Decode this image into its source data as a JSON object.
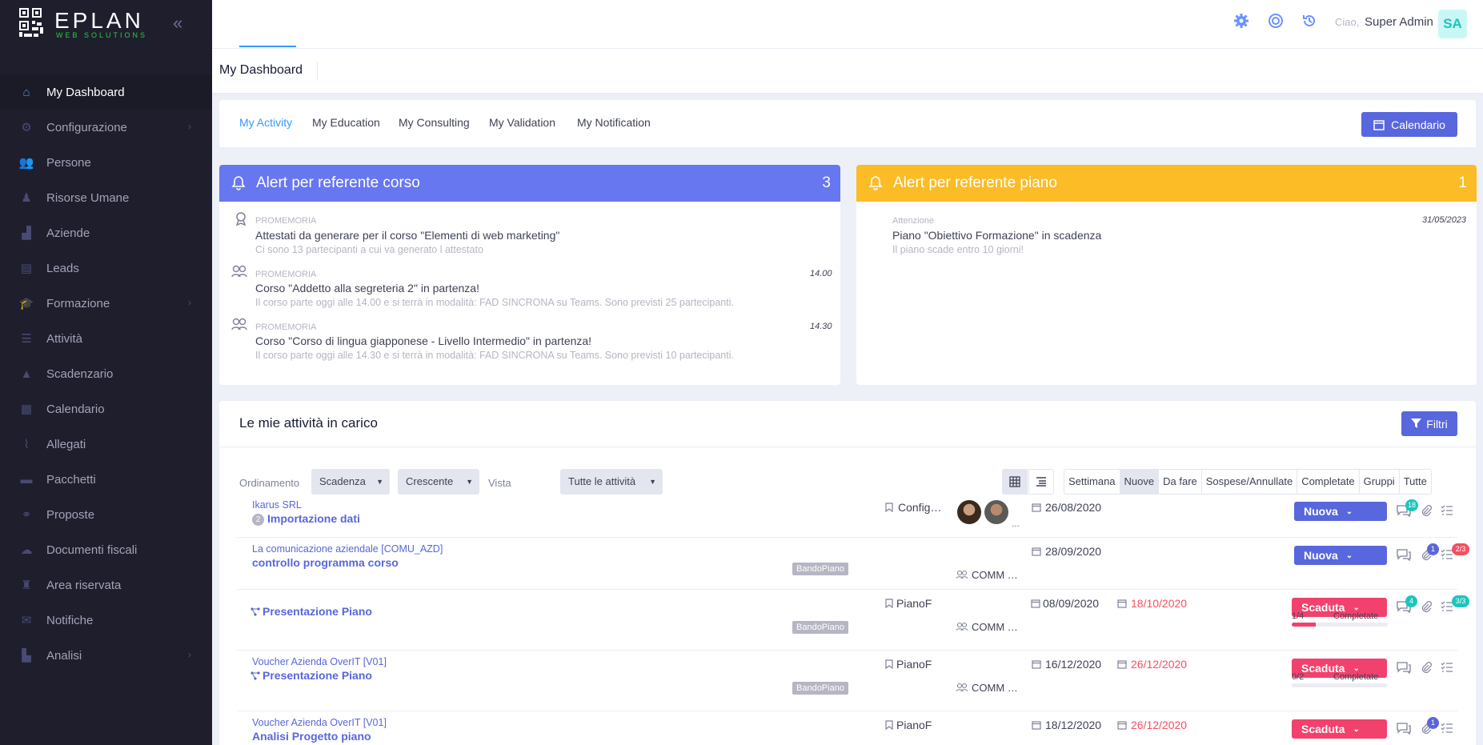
{
  "app": {
    "logo_text": "EPLAN",
    "logo_sub": "WEB SOLUTIONS"
  },
  "sidebar": {
    "items": [
      {
        "label": "My Dashboard",
        "icon": "home-icon",
        "active": true
      },
      {
        "label": "Configurazione",
        "icon": "gear-icon",
        "has_arrow": true
      },
      {
        "label": "Persone",
        "icon": "users-icon"
      },
      {
        "label": "Risorse Umane",
        "icon": "user-tie-icon"
      },
      {
        "label": "Aziende",
        "icon": "industry-icon"
      },
      {
        "label": "Leads",
        "icon": "address-book-icon"
      },
      {
        "label": "Formazione",
        "icon": "graduation-cap-icon",
        "has_arrow": true
      },
      {
        "label": "Attività",
        "icon": "list-icon"
      },
      {
        "label": "Scadenzario",
        "icon": "warning-icon"
      },
      {
        "label": "Calendario",
        "icon": "calendar-icon"
      },
      {
        "label": "Allegati",
        "icon": "paperclip-icon"
      },
      {
        "label": "Pacchetti",
        "icon": "archive-icon"
      },
      {
        "label": "Proposte",
        "icon": "handshake-icon"
      },
      {
        "label": "Documenti fiscali",
        "icon": "cloud-icon"
      },
      {
        "label": "Area riservata",
        "icon": "user-lock-icon"
      },
      {
        "label": "Notifiche",
        "icon": "envelope-icon"
      },
      {
        "label": "Analisi",
        "icon": "chart-icon",
        "has_arrow": true
      }
    ]
  },
  "topbar": {
    "hello": "Ciao,",
    "user_name": "Super Admin",
    "avatar_initials": "SA"
  },
  "subheader": {
    "title": "My Dashboard"
  },
  "tabs": [
    "My Activity",
    "My Education",
    "My Consulting",
    "My Validation",
    "My Notification"
  ],
  "calendar_button": "Calendario",
  "alert_course": {
    "title": "Alert per referente corso",
    "count": "3",
    "items": [
      {
        "category": "PROMEMORIA",
        "title": "Attestati da generare per il corso \"Elementi di web marketing\"",
        "desc": "Ci sono 13 partecipanti a cui va generato l attestato",
        "time": ""
      },
      {
        "category": "PROMEMORIA",
        "title": "Corso \"Addetto alla segreteria 2\" in partenza!",
        "desc": "Il corso parte oggi alle 14.00 e si terrà in modalità: FAD SINCRONA su Teams. Sono previsti 25 partecipanti.",
        "time": "14.00"
      },
      {
        "category": "PROMEMORIA",
        "title": "Corso \"Corso di lingua giapponese - Livello Intermedio\" in partenza!",
        "desc": "Il corso parte oggi alle 14.30 e si terrà in modalità: FAD SINCRONA su Teams. Sono previsti 10 partecipanti.",
        "time": "14.30"
      }
    ]
  },
  "alert_plan": {
    "title": "Alert per referente piano",
    "count": "1",
    "items": [
      {
        "category": "Attenzione",
        "title": "Piano \"Obiettivo Formazione\" in scadenza",
        "desc": "Il piano scade entro 10 giorni!",
        "time": "31/05/2023"
      }
    ]
  },
  "activities": {
    "title": "Le mie attività in carico",
    "filter_button": "Filtri",
    "order_label": "Ordinamento",
    "order_value": "Scadenza",
    "direction_value": "Crescente",
    "view_label": "Vista",
    "view_value": "Tutte le attività",
    "filters": [
      "Settimana",
      "Nuove",
      "Da fare",
      "Sospese/Annullate",
      "Completate",
      "Gruppi",
      "Tutte"
    ],
    "rows": [
      {
        "company": "Ikarus SRL",
        "title": "Importazione dati",
        "num": "2",
        "tag": "",
        "category": "Config…",
        "assignee": "",
        "date1": "26/08/2020",
        "date2": "",
        "status": "Nuova",
        "comments": "18",
        "attachments": "",
        "checklist": "",
        "progress_label": "",
        "progress_value": "",
        "progress_fraction": 0
      },
      {
        "company": "La comunicazione aziendale [COMU_AZD]",
        "title": "controllo programma corso",
        "num": "",
        "tag": "BandoPiano",
        "category": "",
        "assignee": "COMM …",
        "date1": "28/09/2020",
        "date2": "",
        "status": "Nuova",
        "comments": "",
        "attachments": "1",
        "checklist": "2/3",
        "progress_label": "",
        "progress_value": "",
        "progress_fraction": 0
      },
      {
        "company": "",
        "title": "Presentazione Piano",
        "num": "",
        "tag": "BandoPiano",
        "category": "PianoF",
        "assignee": "COMM …",
        "date1": "08/09/2020",
        "date2": "18/10/2020",
        "status": "Scaduta",
        "comments": "4",
        "attachments": "",
        "checklist": "3/3",
        "progress_label": "Completate",
        "progress_value": "1/4",
        "progress_fraction": 0.25
      },
      {
        "company": "Voucher Azienda OverIT [V01]",
        "title": "Presentazione Piano",
        "num": "",
        "tag": "BandoPiano",
        "category": "PianoF",
        "assignee": "COMM …",
        "date1": "16/12/2020",
        "date2": "26/12/2020",
        "status": "Scaduta",
        "comments": "",
        "attachments": "",
        "checklist": "",
        "progress_label": "Completate",
        "progress_value": "0/2",
        "progress_fraction": 0
      },
      {
        "company": "Voucher Azienda OverIT [V01]",
        "title": "Analisi Progetto piano",
        "num": "",
        "tag": "",
        "category": "PianoF",
        "assignee": "",
        "date1": "18/12/2020",
        "date2": "26/12/2020",
        "status": "Scaduta",
        "comments": "",
        "attachments": "1",
        "checklist": "",
        "progress_label": "",
        "progress_value": "",
        "progress_fraction": 0
      }
    ]
  },
  "colors": {
    "primary": "#5867dd",
    "alert_blue": "#6777ef",
    "alert_yellow": "#fbbc26",
    "danger": "#f1416c",
    "sidebar": "#1e1e2d"
  }
}
